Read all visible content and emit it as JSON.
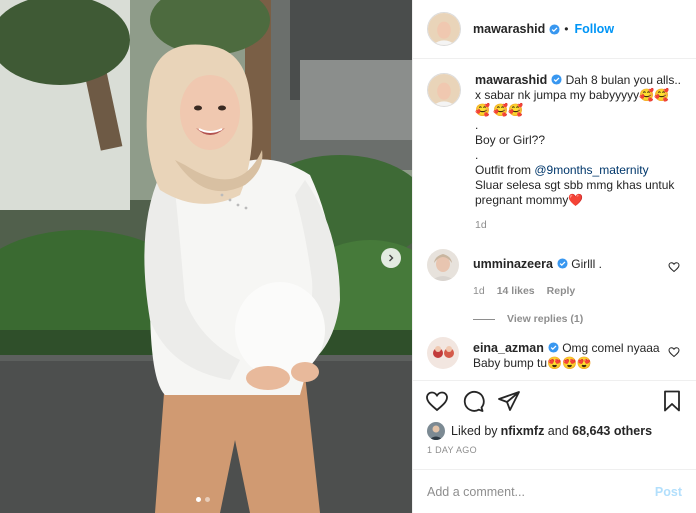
{
  "post_author": {
    "username": "mawarashid",
    "verified_icon": "verified-badge-icon",
    "separator": "•",
    "follow_label": "Follow"
  },
  "caption": {
    "username": "mawarashid",
    "line1": "Dah 8 bulan you alls.. x sabar nk jumpa my babyyyyy🥰🥰🥰",
    "line1b": "🥰🥰",
    "line2": ".",
    "line3": "Boy or Girl??",
    "line4": ".",
    "line5_prefix": "Outfit from ",
    "line5_mention": "@9months_maternity",
    "line6": "Sluar selesa sgt sbb mmg khas untuk pregnant mommy❤️",
    "age": "1d"
  },
  "comments": [
    {
      "username": "umminazeera",
      "text": "Girlll .",
      "age": "1d",
      "likes": "14 likes",
      "reply_label": "Reply",
      "view_replies": "View replies (1)"
    },
    {
      "username": "eina_azman",
      "text": "Omg comel nyaaa",
      "text2": "Baby bump tu😍😍😍"
    }
  ],
  "likes": {
    "prefix": "Liked by ",
    "user": "nfixmfz",
    "middle": " and ",
    "count": "68,643 others"
  },
  "timestamp": "1 DAY AGO",
  "add_comment": {
    "placeholder": "Add a comment...",
    "post_label": "Post"
  },
  "colors": {
    "accent": "#0095f6",
    "mention": "#00376b",
    "muted": "#8e8e8e",
    "post_disabled": "#b2dffc"
  },
  "carousel": {
    "slides": 2,
    "active": 1
  }
}
